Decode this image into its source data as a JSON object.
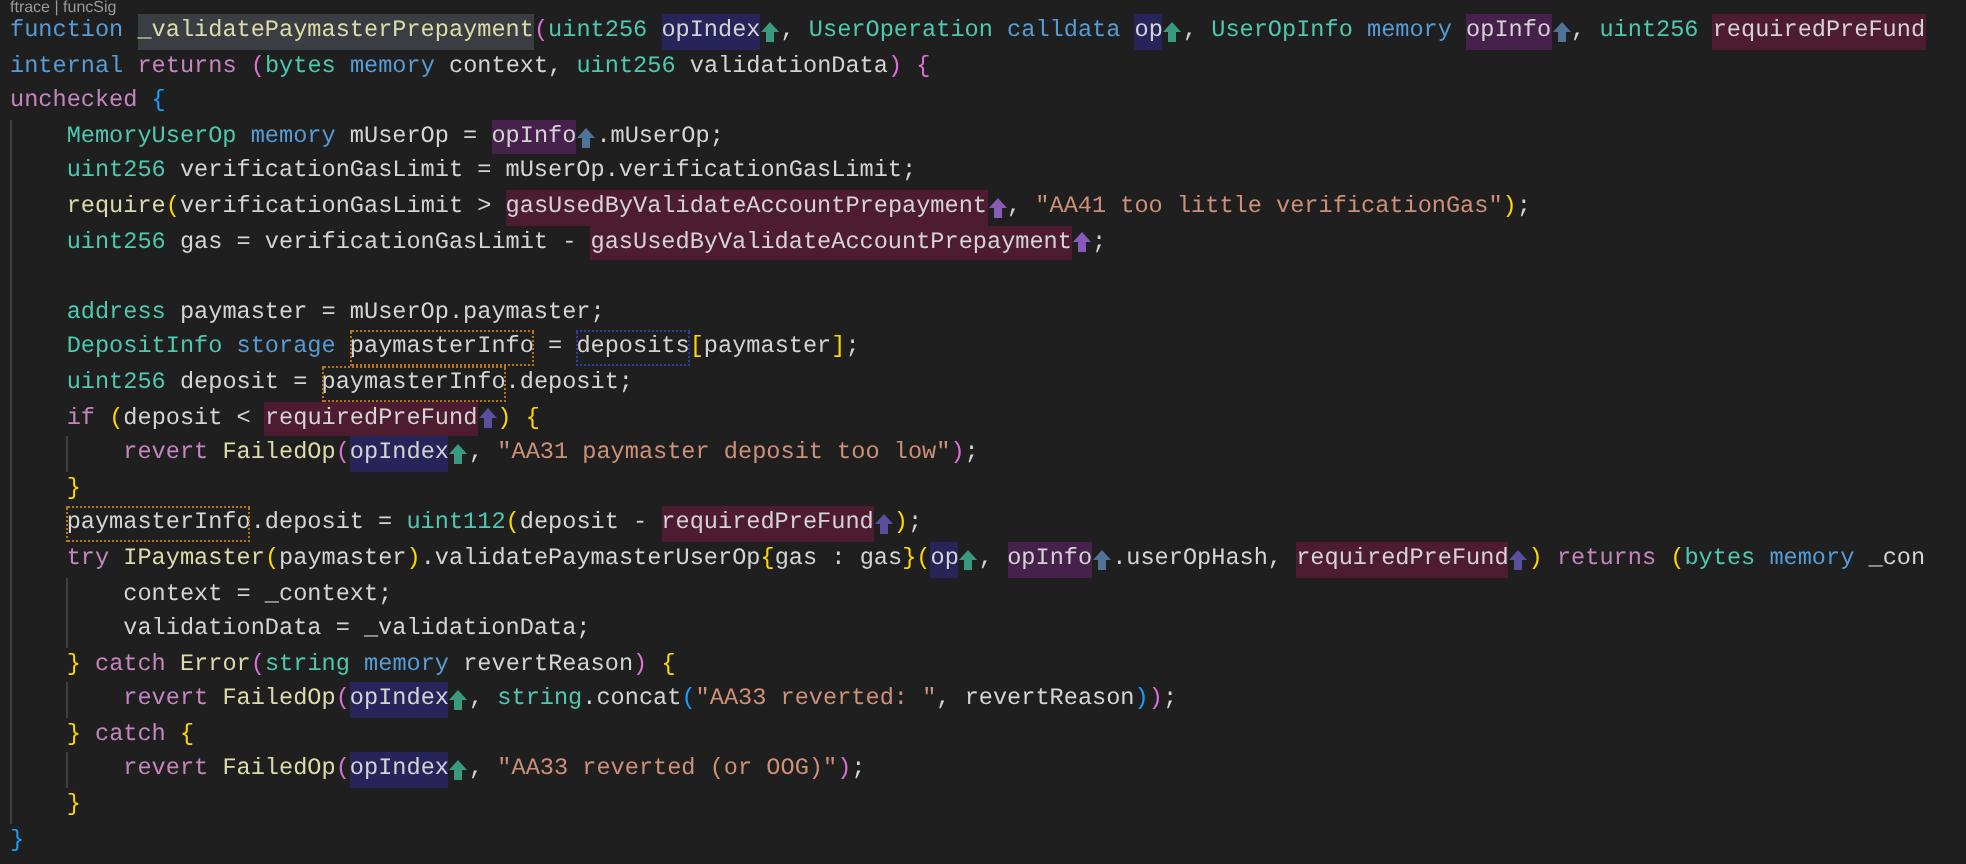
{
  "codelens": "ftrace | funcSig",
  "lines": [
    {
      "tokens": [
        {
          "kind": "kw",
          "text": "function "
        },
        {
          "kind": "fn",
          "text": "_validatePaymasterPrepayment",
          "selected": true
        },
        {
          "kind": "b2",
          "text": "("
        },
        {
          "kind": "type",
          "text": "uint256 "
        },
        {
          "kind": "plain",
          "text": "opIndex",
          "highlighted": true,
          "color": "#262458"
        },
        {
          "kind": "arrow",
          "color": "#3a9a80"
        },
        {
          "kind": "plain",
          "text": ", "
        },
        {
          "kind": "type",
          "text": "UserOperation "
        },
        {
          "kind": "kw",
          "text": "calldata "
        },
        {
          "kind": "plain",
          "text": "op",
          "highlighted": true,
          "color": "#262458"
        },
        {
          "kind": "arrow",
          "color": "#3a9a80"
        },
        {
          "kind": "plain",
          "text": ", "
        },
        {
          "kind": "type",
          "text": "UserOpInfo "
        },
        {
          "kind": "kw",
          "text": "memory "
        },
        {
          "kind": "plain",
          "text": "opInfo",
          "highlighted": true,
          "color": "#46214b"
        },
        {
          "kind": "arrow",
          "color": "#4f7399"
        },
        {
          "kind": "plain",
          "text": ", "
        },
        {
          "kind": "type",
          "text": "uint256 "
        },
        {
          "kind": "plain",
          "text": "requiredPreFund",
          "highlighted": true,
          "color": "#4d1c30"
        }
      ]
    },
    {
      "tokens": [
        {
          "kind": "kw",
          "text": "internal "
        },
        {
          "kind": "ctrl",
          "text": "returns "
        },
        {
          "kind": "b2",
          "text": "("
        },
        {
          "kind": "type",
          "text": "bytes "
        },
        {
          "kind": "kw",
          "text": "memory "
        },
        {
          "kind": "plain",
          "text": "context, "
        },
        {
          "kind": "type",
          "text": "uint256 "
        },
        {
          "kind": "plain",
          "text": "validationData"
        },
        {
          "kind": "b2",
          "text": ") {"
        }
      ]
    },
    {
      "tokens": [
        {
          "kind": "ctrl",
          "text": "unchecked "
        },
        {
          "kind": "b3",
          "text": "{"
        }
      ],
      "children": [
        {
          "tokens": [
            {
              "kind": "type",
              "text": "MemoryUserOp "
            },
            {
              "kind": "kw",
              "text": "memory "
            },
            {
              "kind": "plain",
              "text": "mUserOp = "
            },
            {
              "kind": "plain",
              "text": "opInfo",
              "highlighted": true,
              "color": "#46214b"
            },
            {
              "kind": "arrow",
              "color": "#4f7399"
            },
            {
              "kind": "plain",
              "text": ".mUserOp;"
            }
          ]
        },
        {
          "tokens": [
            {
              "kind": "type",
              "text": "uint256 "
            },
            {
              "kind": "plain",
              "text": "verificationGasLimit = mUserOp.verificationGasLimit;"
            }
          ]
        },
        {
          "tokens": [
            {
              "kind": "fn",
              "text": "require"
            },
            {
              "kind": "b1",
              "text": "("
            },
            {
              "kind": "plain",
              "text": "verificationGasLimit > "
            },
            {
              "kind": "plain",
              "text": "gasUsedByValidateAccountPrepayment",
              "highlighted": true,
              "color": "#4d1c30"
            },
            {
              "kind": "arrow",
              "color": "#8a5ab8"
            },
            {
              "kind": "plain",
              "text": ", "
            },
            {
              "kind": "str",
              "text": "\"AA41 too little verificationGas\""
            },
            {
              "kind": "b1",
              "text": ")"
            },
            {
              "kind": "plain",
              "text": ";"
            }
          ]
        },
        {
          "tokens": [
            {
              "kind": "type",
              "text": "uint256 "
            },
            {
              "kind": "plain",
              "text": "gas = verificationGasLimit - "
            },
            {
              "kind": "plain",
              "text": "gasUsedByValidateAccountPrepayment",
              "highlighted": true,
              "color": "#4d1c30"
            },
            {
              "kind": "arrow",
              "color": "#8a5ab8"
            },
            {
              "kind": "plain",
              "text": ";"
            }
          ]
        },
        {
          "kind": "blank"
        },
        {
          "tokens": [
            {
              "kind": "type",
              "text": "address "
            },
            {
              "kind": "plain",
              "text": "paymaster = mUserOp.paymaster;"
            }
          ]
        },
        {
          "tokens": [
            {
              "kind": "type",
              "text": "DepositInfo "
            },
            {
              "kind": "kw",
              "text": "storage "
            },
            {
              "kind": "plain",
              "text": "paymasterInfo",
              "outlined": true,
              "color": "#b8741a"
            },
            {
              "kind": "plain",
              "text": " = "
            },
            {
              "kind": "plain",
              "text": "deposits",
              "outlined": true,
              "color": "#2a3f9e"
            },
            {
              "kind": "b1",
              "text": "["
            },
            {
              "kind": "plain",
              "text": "paymaster"
            },
            {
              "kind": "b1",
              "text": "]"
            },
            {
              "kind": "plain",
              "text": ";"
            }
          ]
        },
        {
          "tokens": [
            {
              "kind": "type",
              "text": "uint256 "
            },
            {
              "kind": "plain",
              "text": "deposit = "
            },
            {
              "kind": "plain",
              "text": "paymasterInfo",
              "outlined": true,
              "color": "#b8741a"
            },
            {
              "kind": "plain",
              "text": ".deposit;"
            }
          ]
        },
        {
          "tokens": [
            {
              "kind": "ctrl",
              "text": "if "
            },
            {
              "kind": "b1",
              "text": "("
            },
            {
              "kind": "plain",
              "text": "deposit < "
            },
            {
              "kind": "plain",
              "text": "requiredPreFund",
              "highlighted": true,
              "color": "#4d1c30"
            },
            {
              "kind": "arrow",
              "color": "#5a4f9e"
            },
            {
              "kind": "b1",
              "text": ") {"
            }
          ],
          "children": [
            {
              "tokens": [
                {
                  "kind": "ctrl",
                  "text": "revert "
                },
                {
                  "kind": "fn",
                  "text": "FailedOp"
                },
                {
                  "kind": "b2",
                  "text": "("
                },
                {
                  "kind": "plain",
                  "text": "opIndex",
                  "highlighted": true,
                  "color": "#262458"
                },
                {
                  "kind": "arrow",
                  "color": "#3a9a80"
                },
                {
                  "kind": "plain",
                  "text": ", "
                },
                {
                  "kind": "str",
                  "text": "\"AA31 paymaster deposit too low\""
                },
                {
                  "kind": "b2",
                  "text": ")"
                },
                {
                  "kind": "plain",
                  "text": ";"
                }
              ]
            }
          ]
        },
        {
          "tokens": [
            {
              "kind": "b1",
              "text": "}"
            }
          ]
        },
        {
          "tokens": [
            {
              "kind": "plain",
              "text": "paymasterInfo",
              "outlined": true,
              "color": "#b8741a"
            },
            {
              "kind": "plain",
              "text": ".deposit = "
            },
            {
              "kind": "type",
              "text": "uint112"
            },
            {
              "kind": "b1",
              "text": "("
            },
            {
              "kind": "plain",
              "text": "deposit - "
            },
            {
              "kind": "plain",
              "text": "requiredPreFund",
              "highlighted": true,
              "color": "#4d1c30"
            },
            {
              "kind": "arrow",
              "color": "#5a4f9e"
            },
            {
              "kind": "b1",
              "text": ")"
            },
            {
              "kind": "plain",
              "text": ";"
            }
          ]
        },
        {
          "tokens": [
            {
              "kind": "ctrl",
              "text": "try "
            },
            {
              "kind": "fn",
              "text": "IPaymaster"
            },
            {
              "kind": "b1",
              "text": "("
            },
            {
              "kind": "plain",
              "text": "paymaster"
            },
            {
              "kind": "b1",
              "text": ")"
            },
            {
              "kind": "plain",
              "text": ".validatePaymasterUserOp"
            },
            {
              "kind": "b1",
              "text": "{"
            },
            {
              "kind": "plain",
              "text": "gas : gas"
            },
            {
              "kind": "b1",
              "text": "}("
            },
            {
              "kind": "plain",
              "text": "op",
              "highlighted": true,
              "color": "#262458"
            },
            {
              "kind": "arrow",
              "color": "#3a9a80"
            },
            {
              "kind": "plain",
              "text": ", "
            },
            {
              "kind": "plain",
              "text": "opInfo",
              "highlighted": true,
              "color": "#46214b"
            },
            {
              "kind": "arrow",
              "color": "#4f7399"
            },
            {
              "kind": "plain",
              "text": ".userOpHash, "
            },
            {
              "kind": "plain",
              "text": "requiredPreFund",
              "highlighted": true,
              "color": "#4d1c30"
            },
            {
              "kind": "arrow",
              "color": "#5a4f9e"
            },
            {
              "kind": "b1",
              "text": ") "
            },
            {
              "kind": "ctrl",
              "text": "returns "
            },
            {
              "kind": "b1",
              "text": "("
            },
            {
              "kind": "type",
              "text": "bytes "
            },
            {
              "kind": "kw",
              "text": "memory "
            },
            {
              "kind": "plain",
              "text": "_con"
            }
          ],
          "children": [
            {
              "tokens": [
                {
                  "kind": "plain",
                  "text": "context = _context;"
                }
              ]
            },
            {
              "tokens": [
                {
                  "kind": "plain",
                  "text": "validationData = _validationData;"
                }
              ]
            }
          ]
        },
        {
          "tokens": [
            {
              "kind": "b1",
              "text": "} "
            },
            {
              "kind": "ctrl",
              "text": "catch "
            },
            {
              "kind": "fn",
              "text": "Error"
            },
            {
              "kind": "b2",
              "text": "("
            },
            {
              "kind": "type",
              "text": "string "
            },
            {
              "kind": "kw",
              "text": "memory "
            },
            {
              "kind": "plain",
              "text": "revertReason"
            },
            {
              "kind": "b2",
              "text": ")"
            },
            {
              "kind": "b1",
              "text": " {"
            }
          ],
          "children": [
            {
              "tokens": [
                {
                  "kind": "ctrl",
                  "text": "revert "
                },
                {
                  "kind": "fn",
                  "text": "FailedOp"
                },
                {
                  "kind": "b2",
                  "text": "("
                },
                {
                  "kind": "plain",
                  "text": "opIndex",
                  "highlighted": true,
                  "color": "#262458"
                },
                {
                  "kind": "arrow",
                  "color": "#3a9a80"
                },
                {
                  "kind": "plain",
                  "text": ", "
                },
                {
                  "kind": "type",
                  "text": "string"
                },
                {
                  "kind": "plain",
                  "text": ".concat"
                },
                {
                  "kind": "b3",
                  "text": "("
                },
                {
                  "kind": "str",
                  "text": "\"AA33 reverted: \""
                },
                {
                  "kind": "plain",
                  "text": ", revertReason"
                },
                {
                  "kind": "b3",
                  "text": ")"
                },
                {
                  "kind": "b2",
                  "text": ")"
                },
                {
                  "kind": "plain",
                  "text": ";"
                }
              ]
            }
          ]
        },
        {
          "tokens": [
            {
              "kind": "b1",
              "text": "} "
            },
            {
              "kind": "ctrl",
              "text": "catch "
            },
            {
              "kind": "b1",
              "text": "{"
            }
          ],
          "children": [
            {
              "tokens": [
                {
                  "kind": "ctrl",
                  "text": "revert "
                },
                {
                  "kind": "fn",
                  "text": "FailedOp"
                },
                {
                  "kind": "b2",
                  "text": "("
                },
                {
                  "kind": "plain",
                  "text": "opIndex",
                  "highlighted": true,
                  "color": "#262458"
                },
                {
                  "kind": "arrow",
                  "color": "#3a9a80"
                },
                {
                  "kind": "plain",
                  "text": ", "
                },
                {
                  "kind": "str",
                  "text": "\"AA33 reverted (or OOG)\""
                },
                {
                  "kind": "b2",
                  "text": ")"
                },
                {
                  "kind": "plain",
                  "text": ";"
                }
              ]
            }
          ]
        },
        {
          "tokens": [
            {
              "kind": "b1",
              "text": "}"
            }
          ]
        }
      ]
    },
    {
      "tokens": [
        {
          "kind": "b3",
          "text": "}"
        }
      ]
    }
  ]
}
